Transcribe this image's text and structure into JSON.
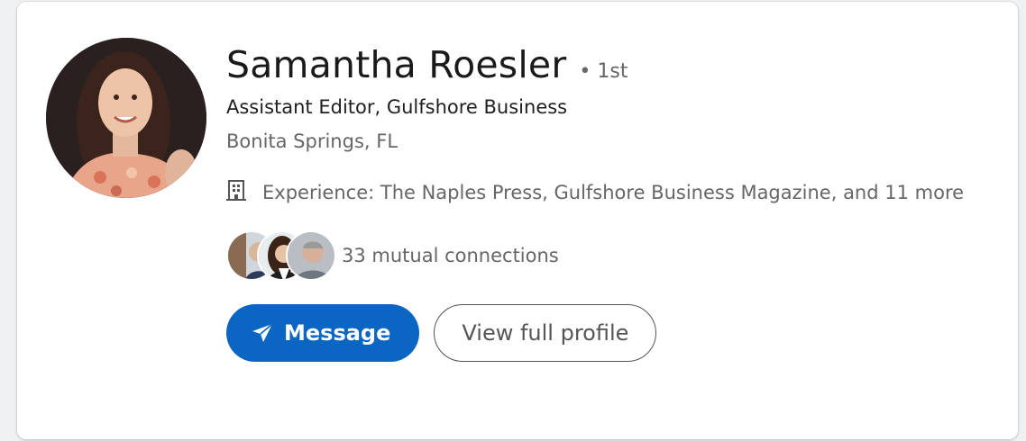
{
  "profile": {
    "name": "Samantha Roesler",
    "degree": "• 1st",
    "headline": "Assistant Editor, Gulfshore Business",
    "location": "Bonita Springs, FL",
    "experience": "Experience: The Naples Press, Gulfshore Business Magazine, and 11 more",
    "experience_icon": "building-icon",
    "avatar_icon": "profile-photo",
    "mutual_connections": "33 mutual connections"
  },
  "actions": {
    "message_label": "Message",
    "message_icon": "send-icon",
    "view_profile_label": "View full profile"
  },
  "colors": {
    "primary": "#0a66c2",
    "text_primary": "#1a1a1a",
    "text_secondary": "#666666",
    "card_bg": "#ffffff"
  }
}
